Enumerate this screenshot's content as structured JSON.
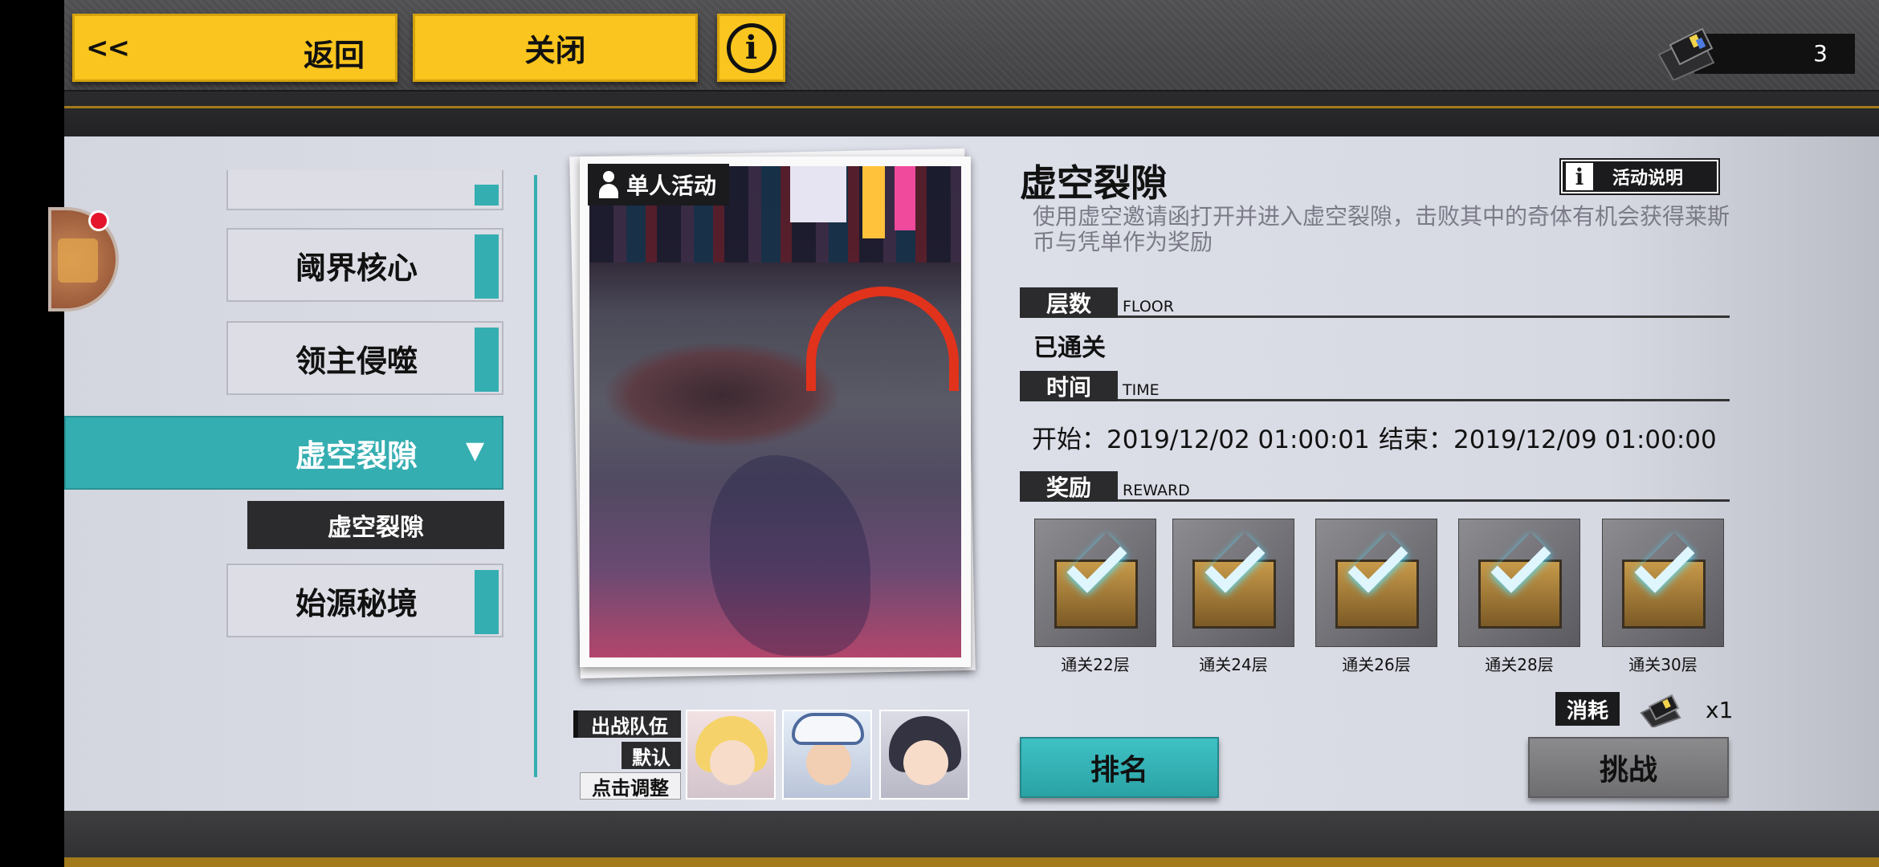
{
  "header": {
    "back_chevron": "<<",
    "back_label": "返回",
    "close_label": "关闭",
    "info_glyph": "i",
    "ticket_count": "3"
  },
  "sidebar": {
    "items": [
      {
        "label": "阈界核心"
      },
      {
        "label": "领主侵噬"
      },
      {
        "label": "虚空裂隙",
        "selected": true,
        "arrow": "▼"
      },
      {
        "label": "始源秘境"
      }
    ],
    "sub_items": [
      {
        "label": "虚空裂隙"
      }
    ]
  },
  "card": {
    "tag": "单人活动"
  },
  "team": {
    "title": "出战队伍",
    "preset": "默认",
    "adjust": "点击调整"
  },
  "event": {
    "title": "虚空裂隙",
    "rules_label": "活动说明",
    "rules_glyph": "i",
    "description": "使用虚空邀请函打开并进入虚空裂隙，击败其中的奇体有机会获得莱斯币与凭单作为奖励",
    "floor_head": "层数",
    "floor_head_en": "FLOOR",
    "floor_value": "已通关",
    "time_head": "时间",
    "time_head_en": "TIME",
    "start": "开始：2019/12/02 01:00:01",
    "end": "结束：2019/12/09 01:00:00",
    "reward_head": "奖励",
    "reward_head_en": "REWARD",
    "rewards": [
      {
        "label": "通关22层",
        "claimed": true
      },
      {
        "label": "通关24层",
        "claimed": true
      },
      {
        "label": "通关26层",
        "claimed": true
      },
      {
        "label": "通关28层",
        "claimed": true
      },
      {
        "label": "通关30层",
        "claimed": true
      }
    ],
    "cost_label": "消耗",
    "cost_qty": "x1"
  },
  "actions": {
    "rank_label": "排名",
    "challenge_label": "挑战"
  },
  "colors": {
    "accent_teal": "#35aeb1",
    "button_yellow": "#f9c51e",
    "dark_label": "#2b2b2d",
    "notification_red": "#e5142d"
  },
  "icons": [
    "chevron-back-icon",
    "info-icon",
    "ticket-icon",
    "chest-icon",
    "person-icon",
    "dropdown-arrow-icon",
    "checkmark-crate-icon"
  ]
}
